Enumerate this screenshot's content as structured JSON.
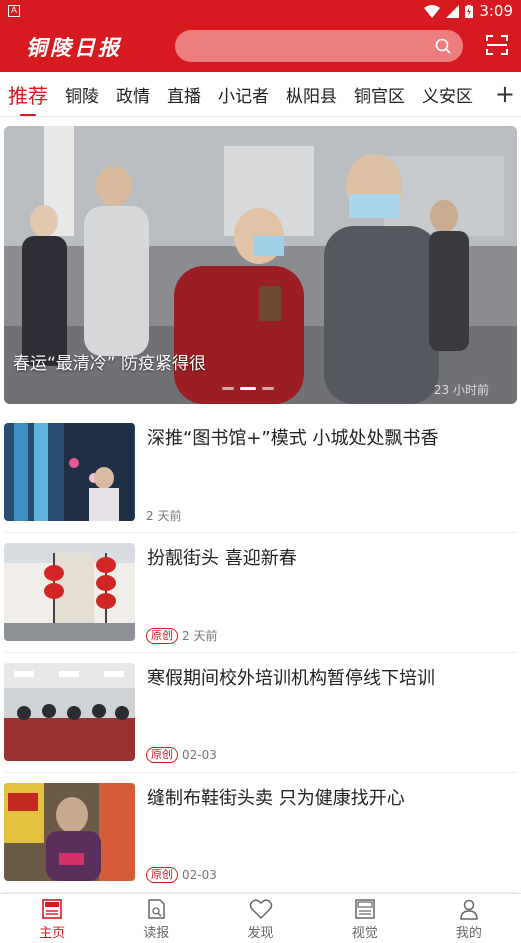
{
  "status": {
    "time": "3:09",
    "indicator": "A"
  },
  "header": {
    "logo": "铜陵日报",
    "search_placeholder": ""
  },
  "channels": {
    "items": [
      "推荐",
      "铜陵",
      "政情",
      "直播",
      "小记者",
      "枞阳县",
      "铜官区",
      "义安区"
    ],
    "active": "推荐"
  },
  "banner": {
    "caption": "春运“最清冷” 防疫紧得很",
    "time": "23 小时前"
  },
  "news": [
    {
      "title": "深推“图书馆+”模式 小城处处飘书香",
      "tag": "",
      "time": "2 天前"
    },
    {
      "title": "扮靓街头 喜迎新春",
      "tag": "原创",
      "time": "2 天前"
    },
    {
      "title": "寒假期间校外培训机构暂停线下培训",
      "tag": "原创",
      "time": "02-03"
    },
    {
      "title": "缝制布鞋街头卖 只为健康找开心",
      "tag": "原创",
      "time": "02-03"
    }
  ],
  "bottom_nav": [
    {
      "label": "主页",
      "icon": "home-news-icon",
      "active": true
    },
    {
      "label": "读报",
      "icon": "newspaper-icon",
      "active": false
    },
    {
      "label": "发现",
      "icon": "heart-icon",
      "active": false
    },
    {
      "label": "视觉",
      "icon": "news-visual-icon",
      "active": false
    },
    {
      "label": "我的",
      "icon": "profile-icon",
      "active": false
    }
  ],
  "colors": {
    "brand_red": "#d71a1f",
    "search_bg": "#ec7e80"
  }
}
